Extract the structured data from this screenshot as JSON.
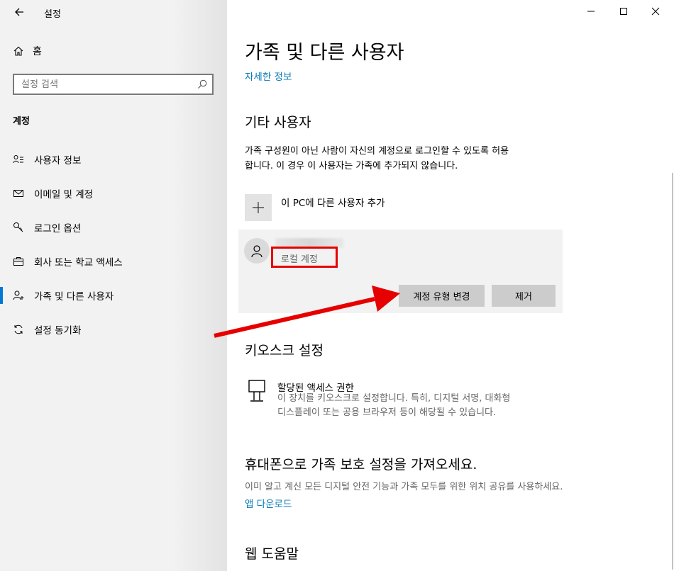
{
  "window": {
    "title": "설정",
    "minimize_glyph": "—",
    "maximize_glyph": "☐",
    "close_glyph": "✕"
  },
  "sidebar": {
    "home_label": "홈",
    "search_placeholder": "설정 검색",
    "section_title": "계정",
    "items": [
      {
        "label": "사용자 정보",
        "icon": "user-info-icon"
      },
      {
        "label": "이메일 및 계정",
        "icon": "mail-icon"
      },
      {
        "label": "로그인 옵션",
        "icon": "key-icon"
      },
      {
        "label": "회사 또는 학교 액세스",
        "icon": "briefcase-icon"
      },
      {
        "label": "가족 및 다른 사용자",
        "icon": "add-person-icon",
        "active": true
      },
      {
        "label": "설정 동기화",
        "icon": "sync-icon"
      }
    ]
  },
  "main": {
    "page_title": "가족 및 다른 사용자",
    "learn_more_link": "자세한 정보",
    "other_users": {
      "heading": "기타 사용자",
      "description_line1": "가족 구성원이 아닌 사람이 자신의 계정으로 로그인할 수 있도록 허용",
      "description_line2": "합니다. 이 경우 이 사용자는 가족에 추가되지 않습니다.",
      "add_user_label": "이 PC에 다른 사용자 추가",
      "user": {
        "account_type": "로컬 계정",
        "change_type_button": "계정 유형 변경",
        "remove_button": "제거"
      }
    },
    "kiosk": {
      "heading": "키오스크 설정",
      "item_title": "할당된 액세스 권한",
      "item_desc_line1": "이 장치를 키오스크로 설정합니다. 특히, 디지털 서명, 대화형",
      "item_desc_line2": "디스플레이 또는 공용 브라우저 등이 해당될 수 있습니다."
    },
    "phone": {
      "heading": "휴대폰으로 가족 보호 설정을 가져오세요.",
      "description": "이미 알고 계신 모든 디지털 안전 기능과 가족 모두를 위한 위치 공유를 사용하세요.",
      "download_link": "앱 다운로드"
    },
    "web_help": {
      "heading": "웹 도움말"
    }
  },
  "colors": {
    "accent": "#0078d7",
    "link": "#0a7ab8",
    "highlight_red": "#e60000",
    "sidebar_bg": "#f2f2f2",
    "panel_bg": "#f2f2f2",
    "button_bg": "#cccccc"
  }
}
